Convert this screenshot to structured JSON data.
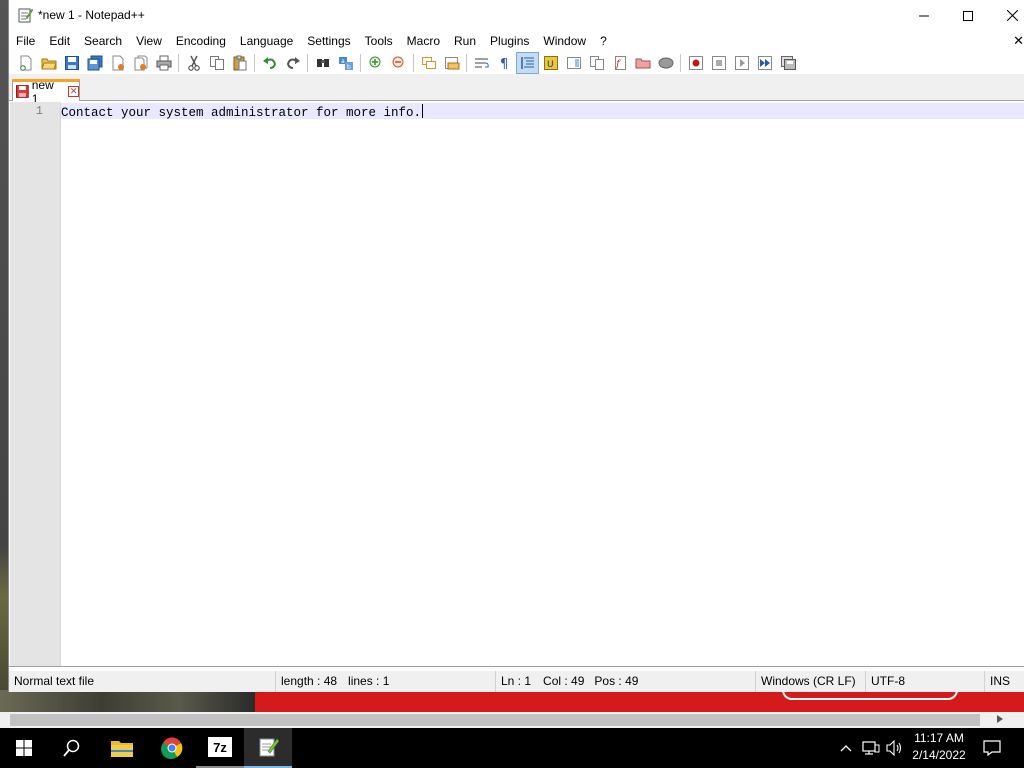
{
  "window": {
    "title": "*new 1 - Notepad++",
    "minimize_glyph": "—",
    "maximize_glyph": "☐",
    "close_glyph": "✕"
  },
  "menu": {
    "items": [
      "File",
      "Edit",
      "Search",
      "View",
      "Encoding",
      "Language",
      "Settings",
      "Tools",
      "Macro",
      "Run",
      "Plugins",
      "Window",
      "?"
    ],
    "close_doc_glyph": "✕"
  },
  "toolbar": {
    "icons": [
      "new-file-icon",
      "open-file-icon",
      "save-icon",
      "save-all-icon",
      "close-icon",
      "close-all-icon",
      "print-icon",
      "cut-icon",
      "copy-icon",
      "paste-icon",
      "undo-icon",
      "redo-icon",
      "find-icon",
      "replace-icon",
      "zoom-in-icon",
      "zoom-out-icon",
      "sync-vertical-icon",
      "sync-horizontal-icon",
      "word-wrap-icon",
      "show-all-characters-icon",
      "indent-guide-icon",
      "user-defined-language-icon",
      "document-map-icon",
      "document-list-icon",
      "function-list-icon",
      "folder-as-workspace-icon",
      "monitoring-icon",
      "record-macro-icon",
      "stop-recording-icon",
      "playback-macro-icon",
      "run-macro-multiple-icon",
      "save-macro-icon"
    ],
    "active_icon": "indent-guide-icon"
  },
  "tabs": [
    {
      "label": "new 1",
      "modified": true,
      "close_glyph": "✕"
    }
  ],
  "editor": {
    "lines": [
      {
        "number": "1",
        "text": "Contact your system administrator for more info."
      }
    ]
  },
  "status": {
    "file_type": "Normal text file",
    "length": "length : 48",
    "lines": "lines : 1",
    "ln": "Ln : 1",
    "col": "Col : 49",
    "pos": "Pos : 49",
    "eol": "Windows (CR LF)",
    "encoding": "UTF-8",
    "mode": "INS"
  },
  "taskbar": {
    "apps": [
      "start-icon",
      "search-icon",
      "file-explorer-icon",
      "chrome-icon",
      "7zip-icon",
      "notepadpp-icon"
    ],
    "active_app": "notepadpp-icon",
    "sevenzip_label": "7z",
    "tray": {
      "chevron_glyph": "^",
      "time": "11:17 AM",
      "date": "2/14/2022"
    }
  },
  "colors": {
    "tab_accent": "#f4a324",
    "current_line": "#e8e8ff",
    "desktop_red": "#d41a1a",
    "taskbar_active_underline": "#7fb8e6"
  }
}
